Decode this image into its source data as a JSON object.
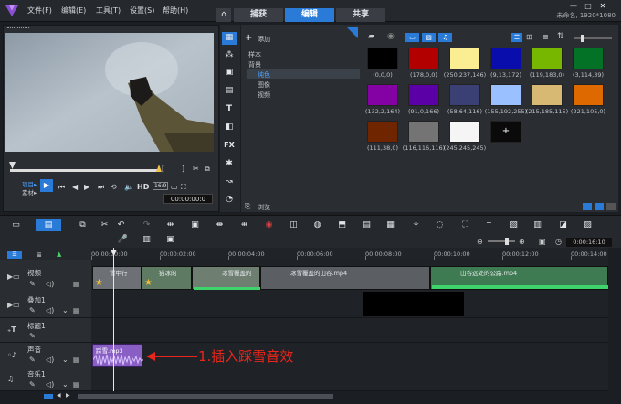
{
  "menu": [
    "文件(F)",
    "编辑(E)",
    "工具(T)",
    "设置(S)",
    "帮助(H)"
  ],
  "tabs": [
    "捕获",
    "编辑",
    "共享"
  ],
  "active_tab": "编辑",
  "project_info": "未命名, 1920*1080",
  "player": {
    "mode_project": "项目▸",
    "mode_clip": "素材▸",
    "hd_label": "HD",
    "timecode": "00:00:00:0"
  },
  "library": {
    "add_label": "添加",
    "tree": [
      "样本",
      "背景",
      "纯色",
      "图像",
      "视频"
    ],
    "browse_label": "浏览",
    "side_icons": [
      "media-icon",
      "transitions-icon",
      "instant-project-icon",
      "title-text-icon",
      "graphics-icon",
      "fx-icon",
      "filter-icon",
      "path-icon",
      "speedometer-icon"
    ]
  },
  "colors": [
    {
      "label": "(0,0,0)",
      "hex": "#000000"
    },
    {
      "label": "(178,0,0)",
      "hex": "#b20000"
    },
    {
      "label": "(250,237,146)",
      "hex": "#faed92"
    },
    {
      "label": "(9,13,172)",
      "hex": "#090dac"
    },
    {
      "label": "(119,183,0)",
      "hex": "#77b700"
    },
    {
      "label": "(3,114,39)",
      "hex": "#037227"
    },
    {
      "label": "(132,2,164)",
      "hex": "#8402a4"
    },
    {
      "label": "(91,0,166)",
      "hex": "#5b00a6"
    },
    {
      "label": "(58,64,116)",
      "hex": "#3a4074"
    },
    {
      "label": "(155,192,255)",
      "hex": "#9bc0ff"
    },
    {
      "label": "(215,185,115)",
      "hex": "#d7b973"
    },
    {
      "label": "(221,105,0)",
      "hex": "#dd6900"
    },
    {
      "label": "(111,38,0)",
      "hex": "#6f2600"
    },
    {
      "label": "(116,116,116)",
      "hex": "#747474"
    },
    {
      "label": "(245,245,245)",
      "hex": "#f5f5f5"
    },
    {
      "label": "+",
      "hex": "#000000"
    }
  ],
  "timeline": {
    "zoom_time": "0:00:16:10",
    "ticks": [
      "00:00:00:00",
      "00:00:02:00",
      "00:00:04:00",
      "00:00:06:00",
      "00:00:08:00",
      "00:00:10:00",
      "00:00:12:00",
      "00:00:14:00"
    ],
    "tracks": [
      {
        "name": "视频"
      },
      {
        "name": "叠加1"
      },
      {
        "name": "标题1"
      },
      {
        "name": "声音"
      },
      {
        "name": "音乐1"
      }
    ],
    "clips": {
      "c1": "雪中行",
      "c2": "猫冰的",
      "c3": "冰雪覆盖的",
      "c4": "冰雪覆盖的山谷.mp4",
      "c5": "山谷远处的公路.mp4",
      "audio": "踩雪.mp3"
    }
  },
  "annotation": "1.插入踩雪音效",
  "accent": "#2a7bd8"
}
